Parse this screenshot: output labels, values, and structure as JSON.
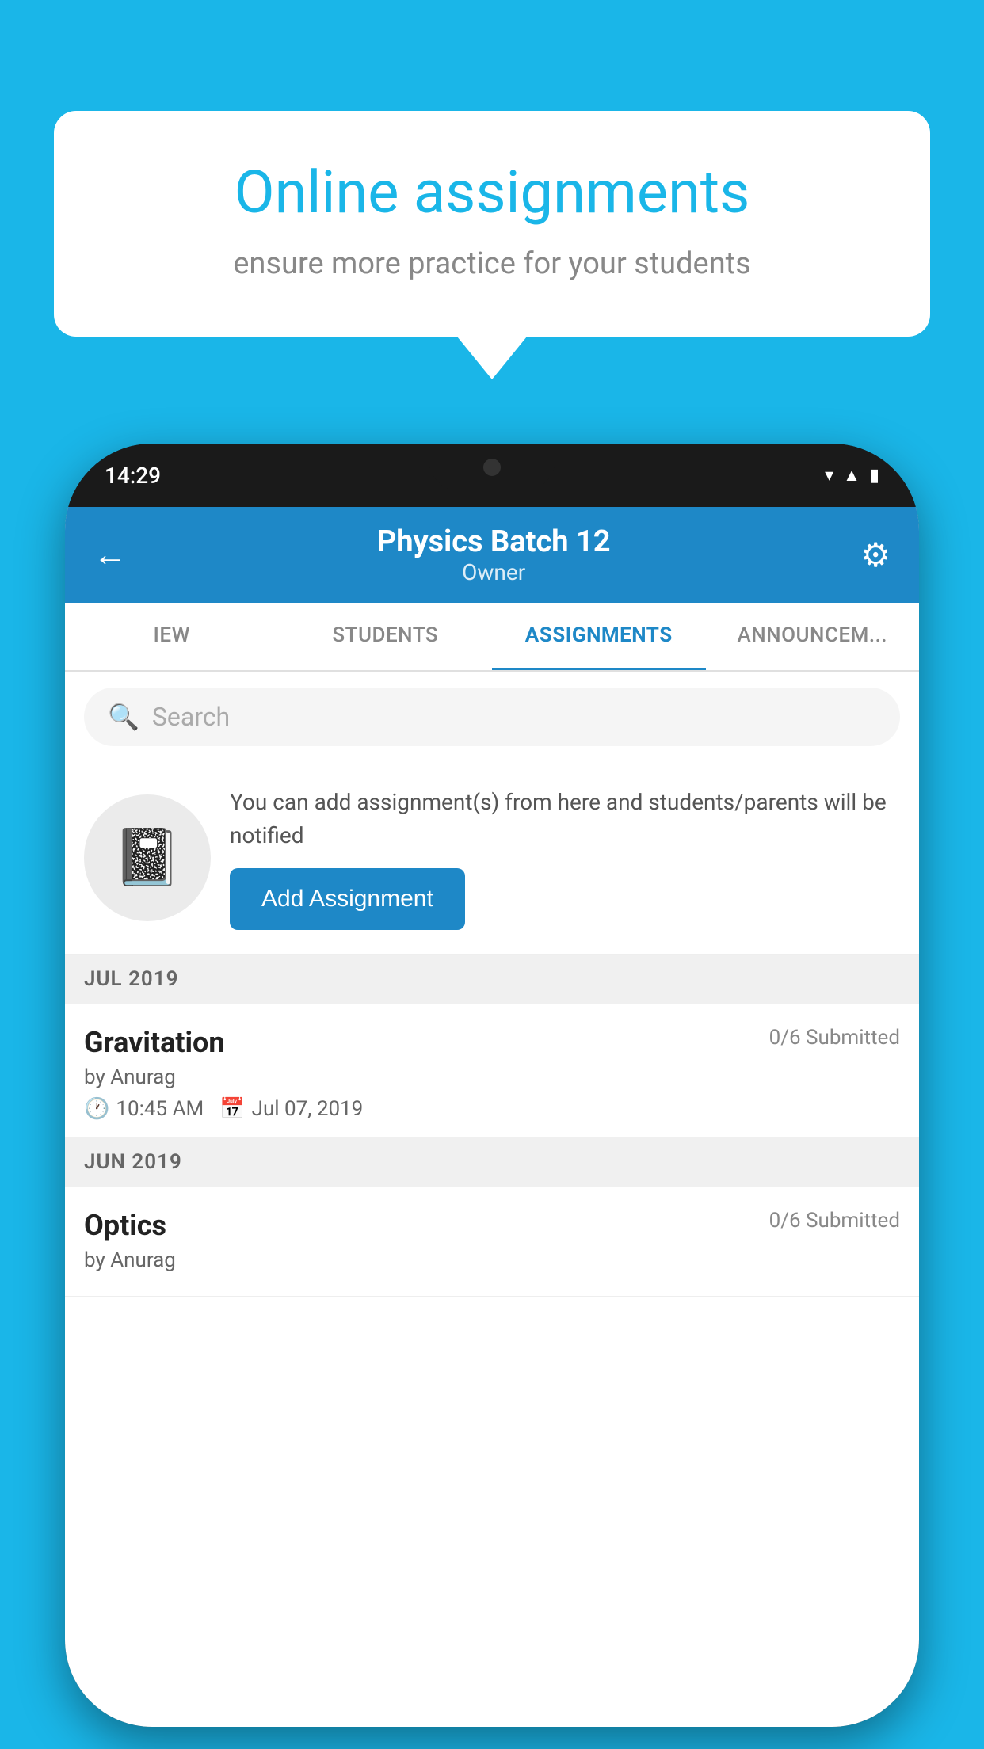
{
  "background_color": "#1ab6e8",
  "speech_bubble": {
    "title": "Online assignments",
    "subtitle": "ensure more practice for your students"
  },
  "phone": {
    "status_bar": {
      "time": "14:29",
      "icons": [
        "wifi",
        "signal",
        "battery"
      ]
    },
    "header": {
      "title": "Physics Batch 12",
      "subtitle": "Owner",
      "back_label": "←",
      "gear_label": "⚙"
    },
    "tabs": [
      {
        "label": "IEW",
        "active": false
      },
      {
        "label": "STUDENTS",
        "active": false
      },
      {
        "label": "ASSIGNMENTS",
        "active": true
      },
      {
        "label": "ANNOUNCEM...",
        "active": false
      }
    ],
    "search": {
      "placeholder": "Search"
    },
    "promo": {
      "description": "You can add assignment(s) from here and students/parents will be notified",
      "button_label": "Add Assignment",
      "icon": "📓"
    },
    "sections": [
      {
        "month_label": "JUL 2019",
        "assignments": [
          {
            "name": "Gravitation",
            "submitted": "0/6 Submitted",
            "by": "by Anurag",
            "time": "10:45 AM",
            "date": "Jul 07, 2019"
          }
        ]
      },
      {
        "month_label": "JUN 2019",
        "assignments": [
          {
            "name": "Optics",
            "submitted": "0/6 Submitted",
            "by": "by Anurag",
            "time": "",
            "date": ""
          }
        ]
      }
    ]
  }
}
